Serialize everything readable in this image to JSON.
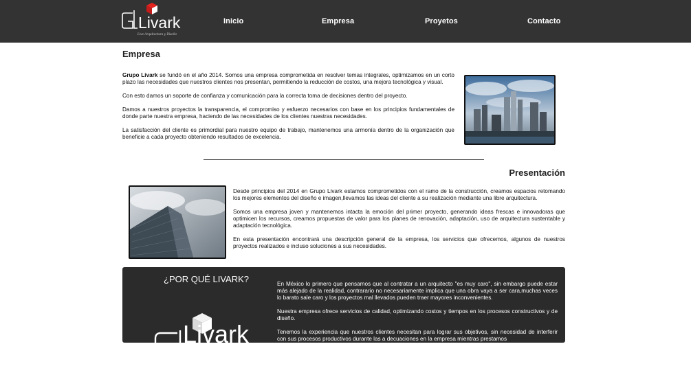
{
  "brand": {
    "logo_text": "Livark",
    "logo_tagline": "Live Arquitectura y Diseño"
  },
  "nav": {
    "items": [
      "Inicio",
      "Empresa",
      "Proyetos",
      "Contacto"
    ]
  },
  "empresa": {
    "heading": "Empresa",
    "bold_lead": "Grupo Livark",
    "para1_rest": " se fundó en el año 2014. Somos una empresa comprometida en resolver temas integrales, optimizamos en un corto plazo las necesidades que nuestros clientes nos presentan, permitiendo la reducción de costos, una mejora tecnológica y visual.",
    "para2": "Con esto damos un soporte de confianza y comunicación para la correcta toma de decisiones dentro del proyecto.",
    "para3": "Damos a nuestros proyectos la transparencia, el compromiso y esfuerzo necesarios con base en los principios fundamentales de donde parte nuestra empresa, haciendo de las necesidades de los clientes nuestras necesidades.",
    "para4": "La satisfacción del cliente es primordial para nuestro equipo de trabajo, mantenemos una armonía dentro de la organización que beneficie a cada proyecto obteniendo resultados de excelencia."
  },
  "presentacion": {
    "heading": "Presentación",
    "para1": "Desde principios del 2014 en Grupo Livark estamos comprometidos con el ramo de la construcción, creamos espacios retomando los mejores elementos del diseño e imagen,llevamos las ideas del cliente a su realización mediante una libre arquitectura.",
    "para2": "Somos una empresa joven y mantenemos intacta la emoción del primer proyecto, generando ideas frescas e innovadoras que optimicen los recursos, creamos propuestas de valor para los planes de renovación, adaptación, uso de arquitectura sustentable y adaptación tecnológica.",
    "para3": "En esta presentación encontrará una descripción general de la empresa, los servicios que ofrecemos, algunos de nuestros proyectos realizados e incluso soluciones a sus necesidades."
  },
  "why": {
    "title": "¿POR QUÉ LIVARK?",
    "logo_text": "Livark",
    "para1": "En México lo primero que pensamos que al contratar a un arquitecto \"es muy caro\", sin embargo puede estar más alejado de la realidad, contrarario no necesariamente implica que una obra vaya a ser cara,muchas veces lo barato sale caro y los proyectos mal llevados pueden traer mayores inconvenientes.",
    "para2": "Nuestra empresa ofrece servicios de calidad, optimizando costos y tiempos en los procesos constructivos y de diseño.",
    "para3": "Tenemos la experiencia que nuestros clientes necesitan para lograr sus objetivos, sin necesidad de interferir con sus procesos productivos durante las a decuaciones en la empresa mientras prestamos"
  }
}
